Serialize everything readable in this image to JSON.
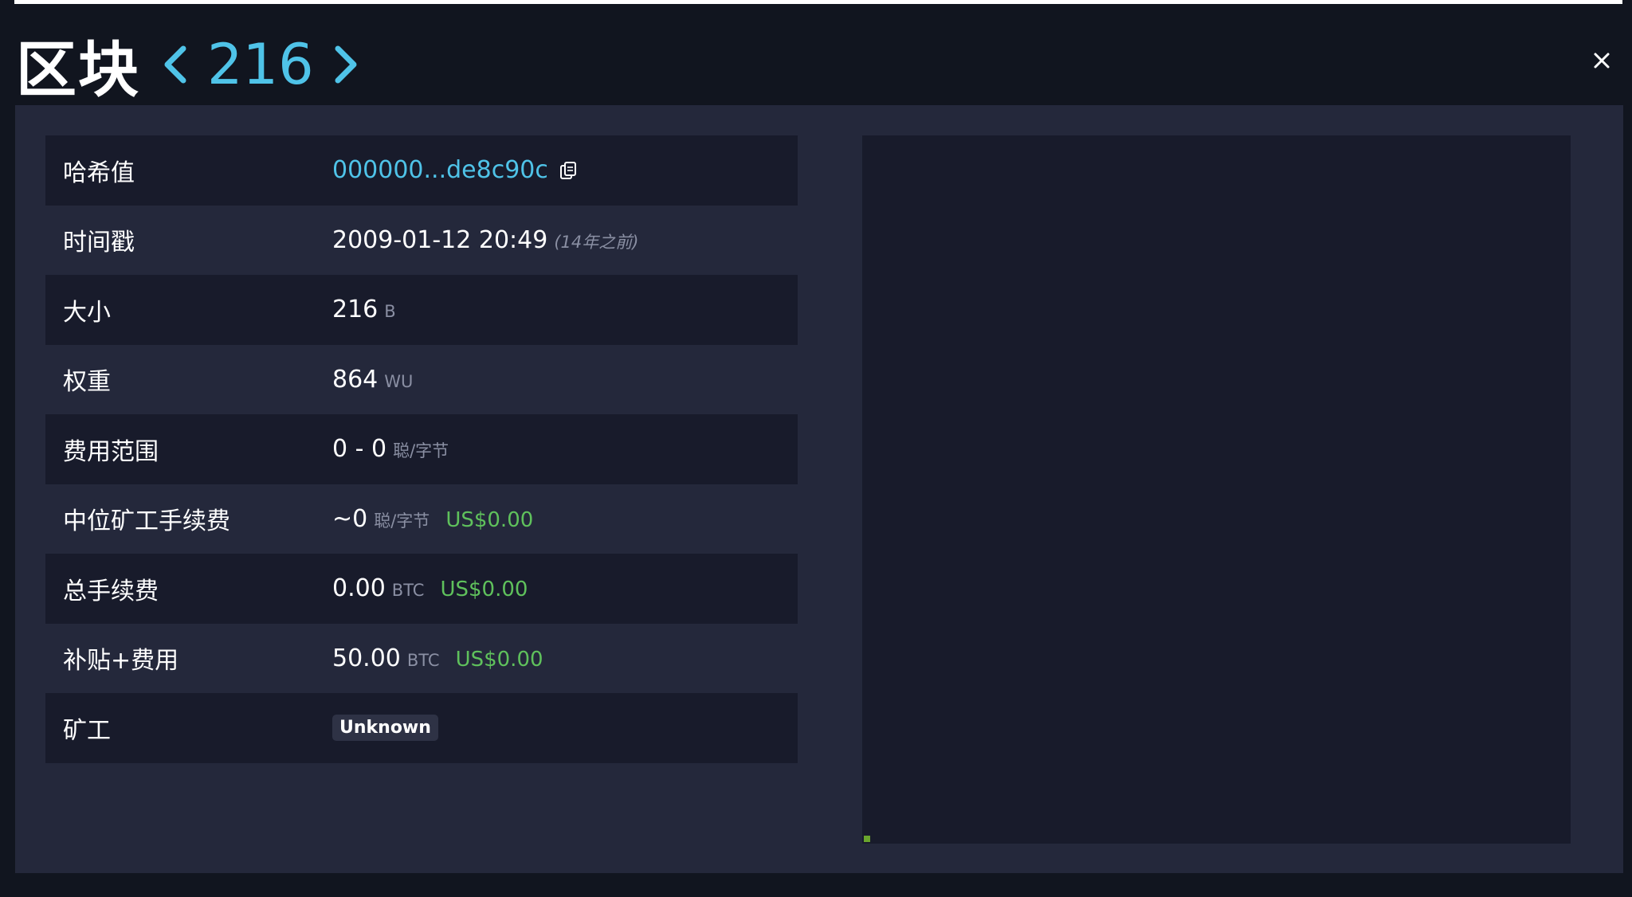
{
  "header": {
    "title": "区块",
    "block_height": "216"
  },
  "details": {
    "hash": {
      "label": "哈希值",
      "value": "000000...de8c90c"
    },
    "timestamp": {
      "label": "时间戳",
      "value": "2009-01-12 20:49",
      "relative": "(14年之前)"
    },
    "size": {
      "label": "大小",
      "value": "216",
      "unit": "B"
    },
    "weight": {
      "label": "权重",
      "value": "864",
      "unit": "WU"
    },
    "fee_span": {
      "label": "费用范围",
      "value": "0 - 0",
      "unit": "聪/字节"
    },
    "median_fee": {
      "label": "中位矿工手续费",
      "value": "~0",
      "unit": "聪/字节",
      "fiat": "US$0.00"
    },
    "total_fees": {
      "label": "总手续费",
      "value": "0.00",
      "unit": "BTC",
      "fiat": "US$0.00"
    },
    "subsidy_fees": {
      "label": "补贴+费用",
      "value": "50.00",
      "unit": "BTC",
      "fiat": "US$0.00"
    },
    "miner": {
      "label": "矿工",
      "value": "Unknown"
    }
  },
  "colors": {
    "accent": "#4fc3e8",
    "fiat": "#5fc15c",
    "tx_square": "#6aa52d"
  },
  "icons": [
    "chevron-left-icon",
    "chevron-right-icon",
    "close-icon",
    "copy-icon"
  ]
}
